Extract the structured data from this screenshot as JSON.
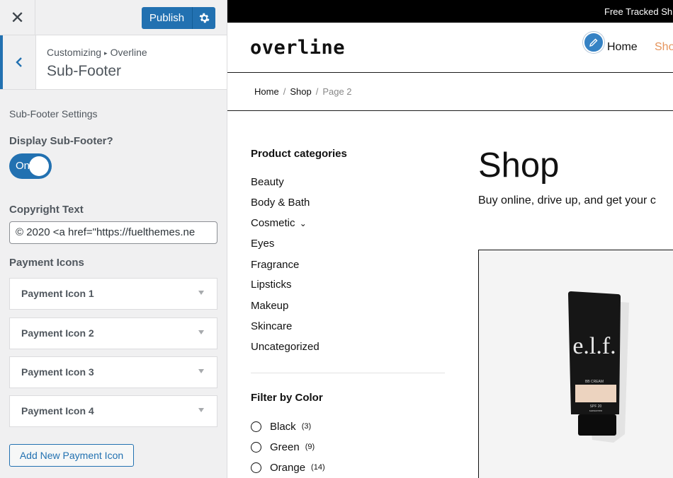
{
  "customizer": {
    "close_icon": "close-icon",
    "publish_label": "Publish",
    "settings_icon": "gear-icon",
    "back_icon": "chevron-left-icon",
    "breadcrumb": {
      "root": "Customizing",
      "separator": "▸",
      "theme": "Overline"
    },
    "section_title": "Sub-Footer",
    "settings_heading": "Sub-Footer Settings",
    "display_label": "Display Sub-Footer?",
    "toggle": {
      "state": "On",
      "enabled": true
    },
    "copyright_label": "Copyright Text",
    "copyright_value": "© 2020 <a href=\"https://fuelthemes.ne",
    "payment_heading": "Payment Icons",
    "payment_items": [
      "Payment Icon 1",
      "Payment Icon 2",
      "Payment Icon 3",
      "Payment Icon 4"
    ],
    "add_payment_label": "Add New Payment Icon",
    "accent_color": "#2271b1"
  },
  "preview": {
    "topbar_text": "Free Tracked Shi",
    "logo": "overline",
    "nav": {
      "home": "Home",
      "shop": "Sho"
    },
    "nav_shop_color": "#e5945c",
    "breadcrumb": {
      "home": "Home",
      "shop": "Shop",
      "current": "Page 2",
      "separator": "/"
    },
    "categories_title": "Product categories",
    "categories": [
      "Beauty",
      "Body & Bath",
      "Cosmetic",
      "Eyes",
      "Fragrance",
      "Lipsticks",
      "Makeup",
      "Skincare",
      "Uncategorized"
    ],
    "cosmetic_expand": "⌄",
    "filter_title": "Filter by Color",
    "colors": [
      {
        "name": "Black",
        "count": "(3)"
      },
      {
        "name": "Green",
        "count": "(9)"
      },
      {
        "name": "Orange",
        "count": "(14)"
      }
    ],
    "shop_title": "Shop",
    "shop_subtitle": "Buy online, drive up, and get your c",
    "product_brand": "e.l.f.",
    "product_name": "BB CREAM",
    "product_spf": "SPF 20",
    "product_tag": "sunscreen"
  }
}
